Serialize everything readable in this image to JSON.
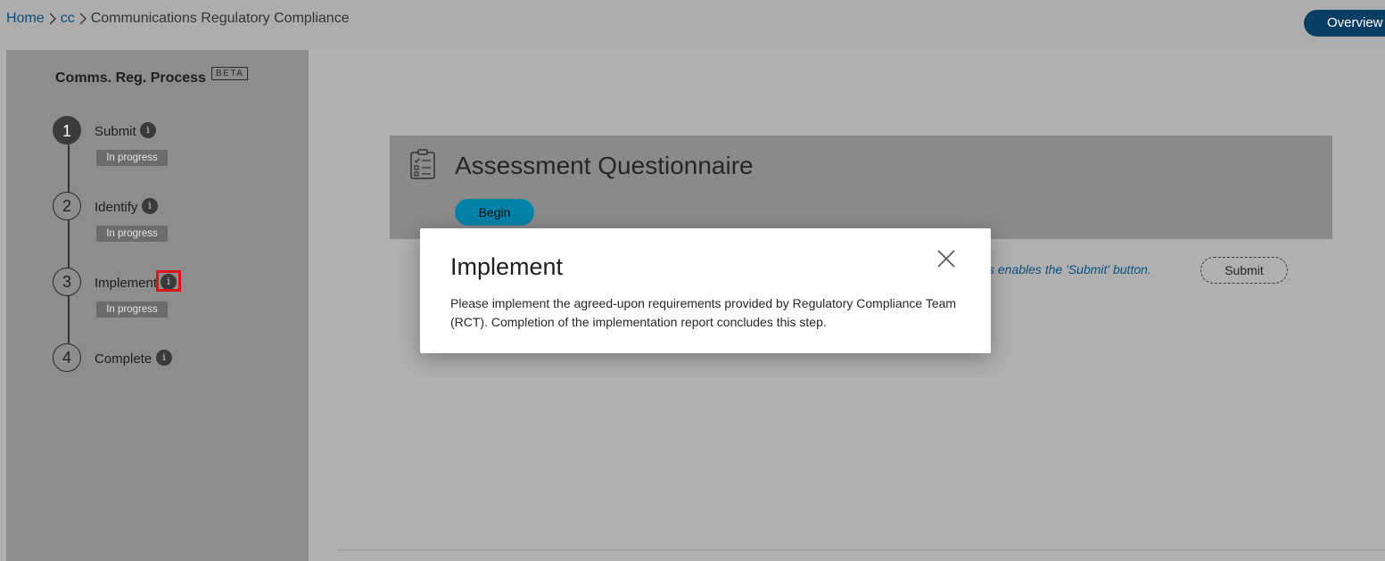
{
  "breadcrumb": {
    "home": "Home",
    "cc": "cc",
    "current": "Communications Regulatory Compliance"
  },
  "header": {
    "overview_label": "Overview"
  },
  "sidebar": {
    "title": "Comms. Reg. Process",
    "beta": "BETA",
    "steps": [
      {
        "number": "1",
        "label": "Submit",
        "status": "In progress"
      },
      {
        "number": "2",
        "label": "Identify",
        "status": "In progress"
      },
      {
        "number": "3",
        "label": "Implement",
        "status": "In progress"
      },
      {
        "number": "4",
        "label": "Complete",
        "status": ""
      }
    ],
    "info_glyph": "i"
  },
  "main": {
    "card_title": "Assessment Questionnaire",
    "begin_label": "Begin",
    "hint_text": "s enables the 'Submit' button.",
    "submit_label": "Submit"
  },
  "modal": {
    "title": "Implement",
    "body": "Please implement the agreed-upon requirements provided by Regulatory Compliance Team (RCT). Completion of the implementation report concludes this step."
  },
  "colors": {
    "link": "#0d4f7a",
    "overview_bg": "#0b3e63",
    "begin_bg": "#0582a9",
    "highlight": "#d9151b"
  },
  "icons": [
    "chevron-right-icon",
    "info-icon",
    "clipboard-checklist-icon",
    "close-icon"
  ]
}
